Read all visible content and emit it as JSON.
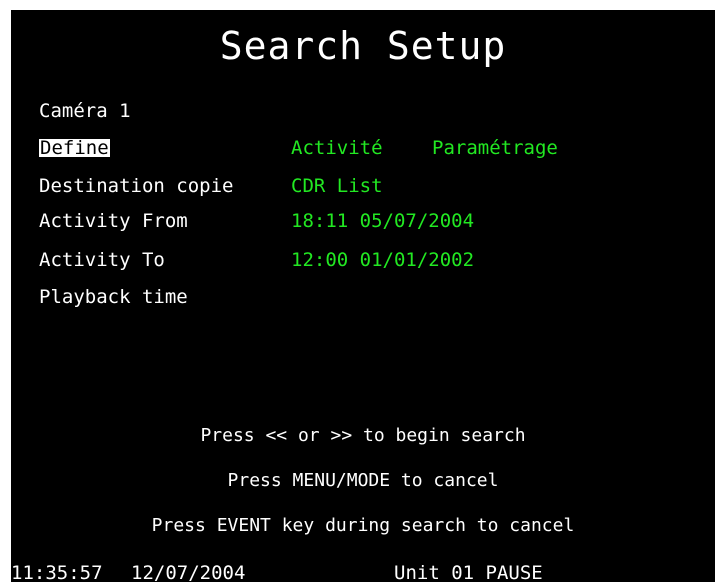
{
  "title": "Search Setup",
  "camera_label": "Caméra 1",
  "fields": {
    "define": {
      "label": "Define",
      "value1": "Activité",
      "value2": "Paramétrage"
    },
    "destination": {
      "label": "Destination copie",
      "value": "CDR List"
    },
    "activity_from": {
      "label": "Activity From",
      "value": "18:11 05/07/2004"
    },
    "activity_to": {
      "label": "Activity To",
      "value": "12:00 01/01/2002"
    },
    "playback": {
      "label": "Playback time",
      "value": ""
    }
  },
  "help": {
    "line1": "Press << or >> to begin search",
    "line2": "Press MENU/MODE to cancel",
    "line3": "Press EVENT key during search to cancel"
  },
  "status": {
    "time": "11:35:57",
    "date": "12/07/2004",
    "unit": "Unit 01 PAUSE"
  },
  "colors": {
    "background": "#000000",
    "text": "#ffffff",
    "value": "#22e822",
    "selection": "#ffffff"
  }
}
